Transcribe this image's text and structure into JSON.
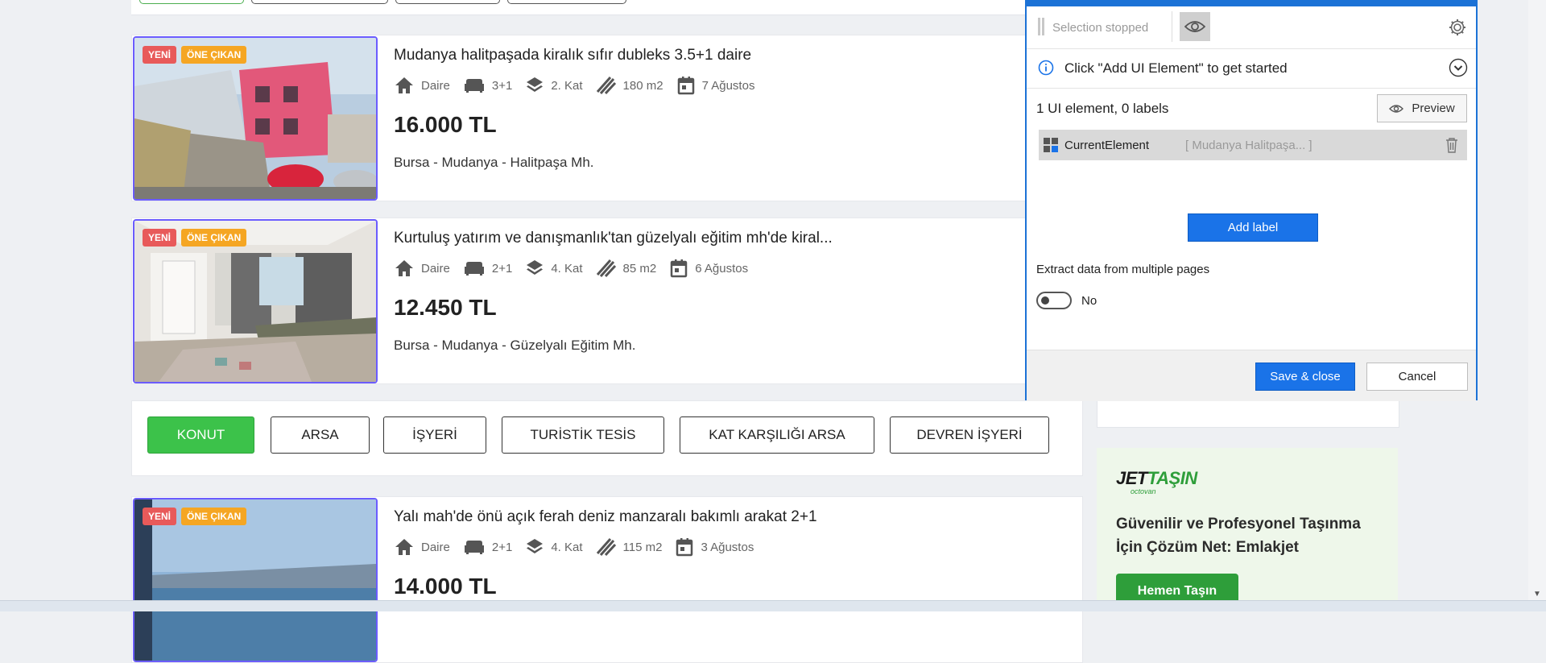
{
  "listings": [
    {
      "badges": {
        "new": "YENİ",
        "featured": "ÖNE ÇIKAN"
      },
      "title": "Mudanya halitpaşada kiralık sıfır dubleks 3.5+1 daire",
      "type": "Daire",
      "rooms": "3+1",
      "floor": "2. Kat",
      "area": "180 m2",
      "date": "7 Ağustos",
      "price": "16.000 TL",
      "location": "Bursa - Mudanya - Halitpaşa Mh."
    },
    {
      "badges": {
        "new": "YENİ",
        "featured": "ÖNE ÇIKAN"
      },
      "title": "Kurtuluş yatırım ve danışmanlık'tan güzelyalı eğitim mh'de kiral...",
      "type": "Daire",
      "rooms": "2+1",
      "floor": "4. Kat",
      "area": "85 m2",
      "date": "6 Ağustos",
      "price": "12.450 TL",
      "location": "Bursa - Mudanya - Güzelyalı Eğitim Mh."
    },
    {
      "badges": {
        "new": "YENİ",
        "featured": "ÖNE ÇIKAN"
      },
      "title": "Yalı mah'de önü açık ferah deniz manzaralı bakımlı arakat 2+1",
      "type": "Daire",
      "rooms": "2+1",
      "floor": "4. Kat",
      "area": "115 m2",
      "date": "3 Ağustos",
      "price": "14.000 TL",
      "location": ""
    }
  ],
  "categories": [
    "KONUT",
    "ARSA",
    "İŞYERİ",
    "TURİSTİK TESİS",
    "KAT KARŞILIĞI ARSA",
    "DEVREN İŞYERİ"
  ],
  "ad": {
    "logo_main": "JET",
    "logo_accent": "TAŞIN",
    "logo_sub": "octovan",
    "text": "Güvenilir ve Profesyonel Taşınma İçin Çözüm Net: Emlakjet",
    "button": "Hemen Taşın"
  },
  "dialog": {
    "selection_status": "Selection stopped",
    "info": "Click \"Add UI Element\" to get started",
    "count": "1 UI element, 0 labels",
    "preview": "Preview",
    "element_name": "CurrentElement",
    "element_value": "[ Mudanya Halitpaşa...  ]",
    "add_label": "Add label",
    "extract_label": "Extract data from multiple pages",
    "toggle_value": "No",
    "save": "Save & close",
    "cancel": "Cancel"
  },
  "colors": {
    "accent": "#1a73e8",
    "active_category": "#3cc24a",
    "badge_new": "#e85a5a",
    "badge_featured": "#f5a623",
    "selection_border": "#6b5cff"
  }
}
